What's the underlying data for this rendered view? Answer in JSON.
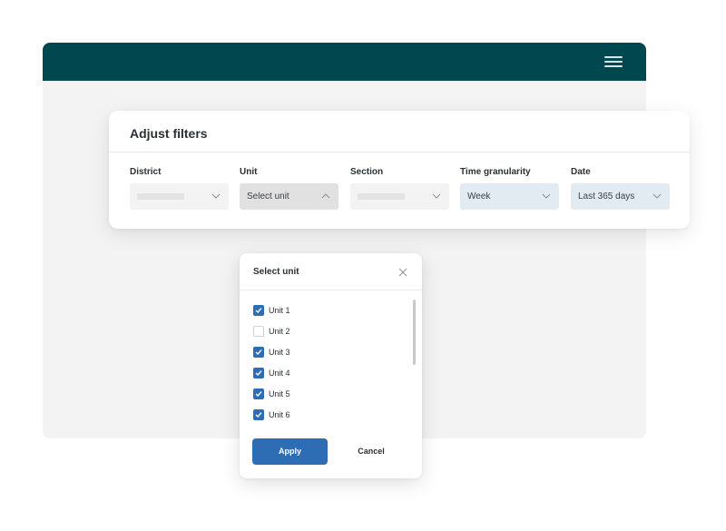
{
  "header": {
    "menu_icon": "hamburger-menu-icon",
    "color": "#004750"
  },
  "filters": {
    "title": "Adjust filters",
    "items": [
      {
        "label": "District",
        "value": ""
      },
      {
        "label": "Unit",
        "value": "Select unit"
      },
      {
        "label": "Section",
        "value": ""
      },
      {
        "label": "Time granularity",
        "value": "Week"
      },
      {
        "label": "Date",
        "value": "Last 365 days"
      }
    ]
  },
  "unit_dialog": {
    "title": "Select unit",
    "units": [
      {
        "label": "Unit 1",
        "checked": true
      },
      {
        "label": "Unit 2",
        "checked": false
      },
      {
        "label": "Unit 3",
        "checked": true
      },
      {
        "label": "Unit 4",
        "checked": true
      },
      {
        "label": "Unit 5",
        "checked": true
      },
      {
        "label": "Unit 6",
        "checked": true
      }
    ],
    "apply_label": "Apply",
    "cancel_label": "Cancel",
    "accent": "#2e6db4"
  }
}
